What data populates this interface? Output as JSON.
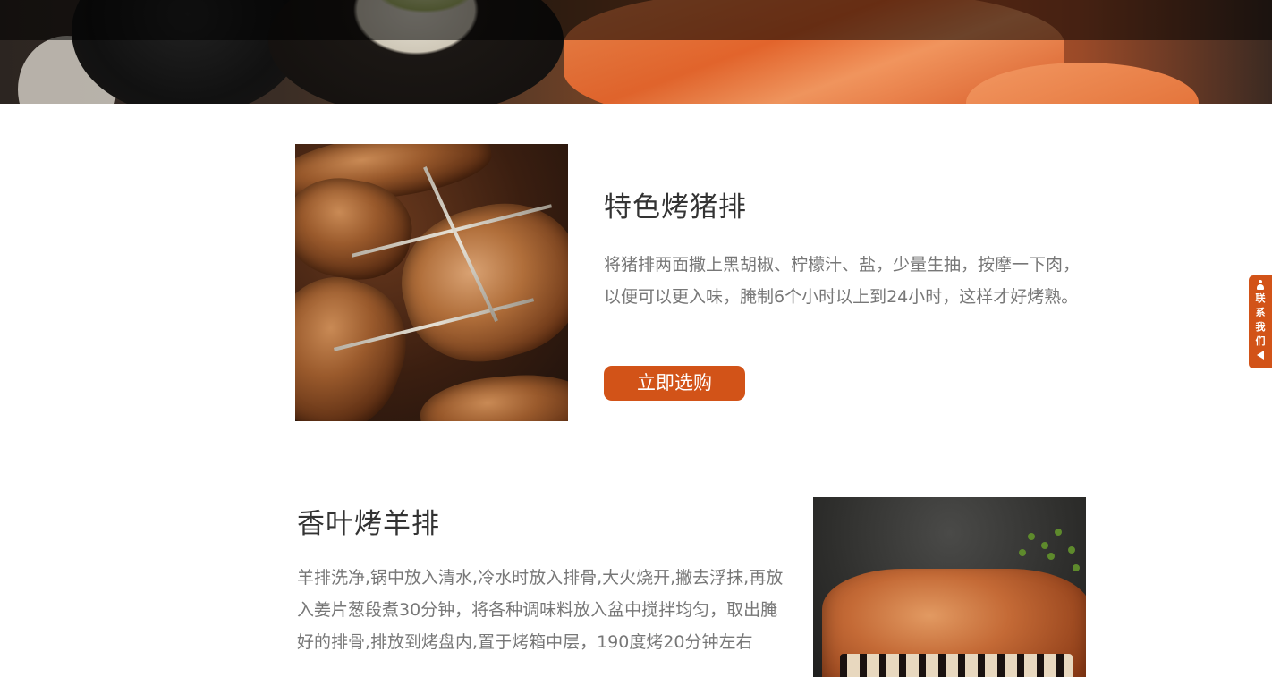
{
  "colors": {
    "accent": "#d25318",
    "title_text": "#333333",
    "body_text": "#777777"
  },
  "products": [
    {
      "title": "特色烤猪排",
      "description": "将猪排两面撒上黑胡椒、柠檬汁、盐，少量生抽，按摩一下肉，以便可以更入味，腌制6个小时以上到24小时，这样才好烤熟。",
      "button_label": "立即选购"
    },
    {
      "title": "香叶烤羊排",
      "description": "羊排洗净,锅中放入清水,冷水时放入排骨,大火烧开,撇去浮抹,再放入姜片葱段煮30分钟，将各种调味料放入盆中搅拌均匀，取出腌好的排骨,排放到烤盘内,置于烤箱中层，190度烤20分钟左右"
    }
  ],
  "contact_tab": {
    "label": "联系我们",
    "icons": [
      "person-icon",
      "arrow-left-icon"
    ]
  }
}
